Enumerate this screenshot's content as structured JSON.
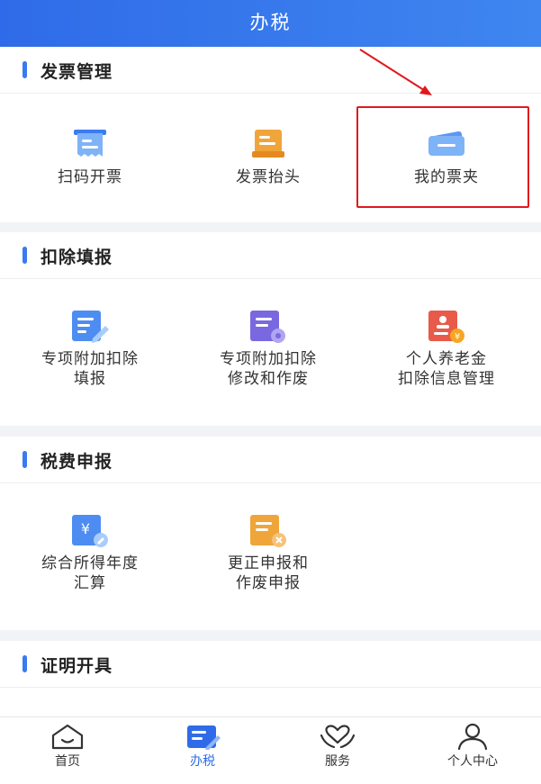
{
  "header": {
    "title": "办税"
  },
  "sections": [
    {
      "title": "发票管理",
      "items": [
        {
          "label": "扫码开票"
        },
        {
          "label": "发票抬头"
        },
        {
          "label": "我的票夹"
        }
      ]
    },
    {
      "title": "扣除填报",
      "items": [
        {
          "label": "专项附加扣除\n填报"
        },
        {
          "label": "专项附加扣除\n修改和作废"
        },
        {
          "label": "个人养老金\n扣除信息管理"
        }
      ]
    },
    {
      "title": "税费申报",
      "items": [
        {
          "label": "综合所得年度\n汇算"
        },
        {
          "label": "更正申报和\n作废申报"
        }
      ]
    },
    {
      "title": "证明开具",
      "items": []
    }
  ],
  "tabs": [
    {
      "label": "首页",
      "icon": "home-icon"
    },
    {
      "label": "办税",
      "icon": "tax-icon",
      "active": true
    },
    {
      "label": "服务",
      "icon": "heart-hands-icon"
    },
    {
      "label": "个人中心",
      "icon": "person-icon"
    }
  ],
  "colors": {
    "primary": "#2f6be8",
    "highlight": "#e0191f"
  }
}
